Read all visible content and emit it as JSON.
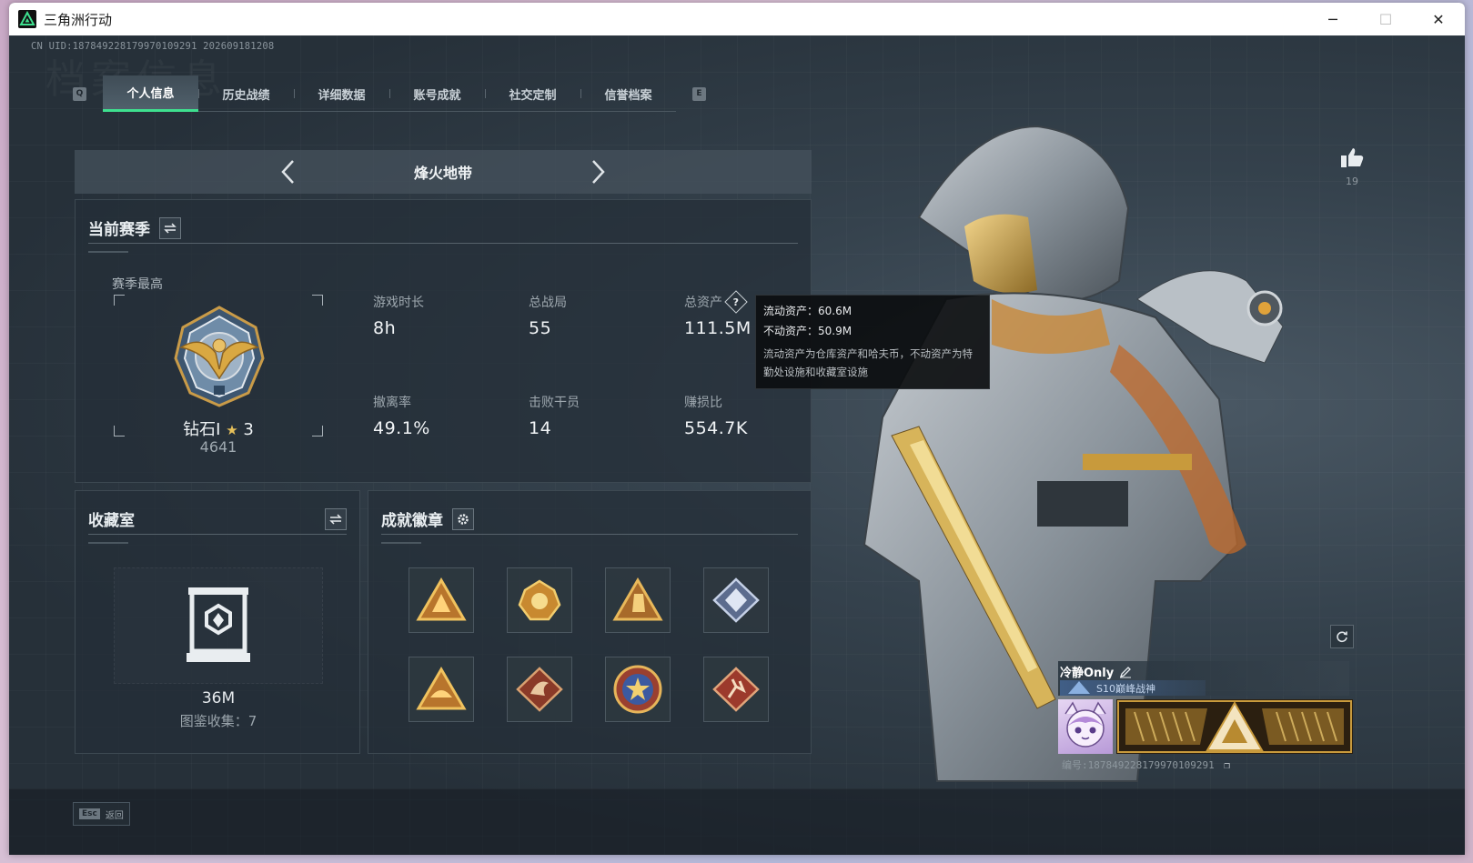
{
  "window": {
    "title": "三角洲行动",
    "min_icon": "minimize-icon",
    "max_icon": "maximize-icon",
    "close_icon": "close-icon"
  },
  "header": {
    "uid": "CN UID:18784922817997010929​1 202609181208",
    "watermark": "档案信息"
  },
  "tabs": {
    "left_key": "Q",
    "right_key": "E",
    "items": [
      {
        "label": "个人信息",
        "active": true
      },
      {
        "label": "历史战绩",
        "active": false
      },
      {
        "label": "详细数据",
        "active": false
      },
      {
        "label": "账号成就",
        "active": false
      },
      {
        "label": "社交定制",
        "active": false
      },
      {
        "label": "信誉档案",
        "active": false
      }
    ]
  },
  "mode": {
    "title": "烽火地带"
  },
  "current_season": {
    "title": "当前赛季",
    "season_best_label": "赛季最高",
    "rank_name": "钻石I",
    "rank_stars": "3",
    "rank_score": "4641",
    "stats": [
      {
        "label": "游戏时长",
        "value": "8h"
      },
      {
        "label": "总战局",
        "value": "55"
      },
      {
        "label": "总资产",
        "value": "111.5M",
        "has_help": true
      },
      {
        "label": "撤离率",
        "value": "49.1%"
      },
      {
        "label": "击败干员",
        "value": "14"
      },
      {
        "label": "赚损比",
        "value": "554.7K"
      }
    ]
  },
  "tooltip": {
    "liquid": "流动资产：60.6M",
    "fixed": "不动资产：50.9M",
    "desc": "流动资产为仓库资产和哈夫币，不动资产为特勤处设施和收藏室设施"
  },
  "collection": {
    "title": "收藏室",
    "value": "36M",
    "count": "图鉴收集：7"
  },
  "achievements": {
    "title": "成就徽章",
    "badges": [
      "badge-1",
      "badge-2",
      "badge-3",
      "badge-4",
      "badge-5",
      "badge-6",
      "badge-7",
      "badge-8"
    ]
  },
  "likes": {
    "count": "19"
  },
  "player": {
    "name": "冷静Only",
    "title": "S10巅峰战神",
    "id": "编号:18784922817997010929​1"
  },
  "footer": {
    "esc_key": "Esc",
    "esc_label": "返回"
  },
  "colors": {
    "accent": "#3ee08f",
    "panel": "#242e37",
    "gold": "#c89a3c"
  }
}
